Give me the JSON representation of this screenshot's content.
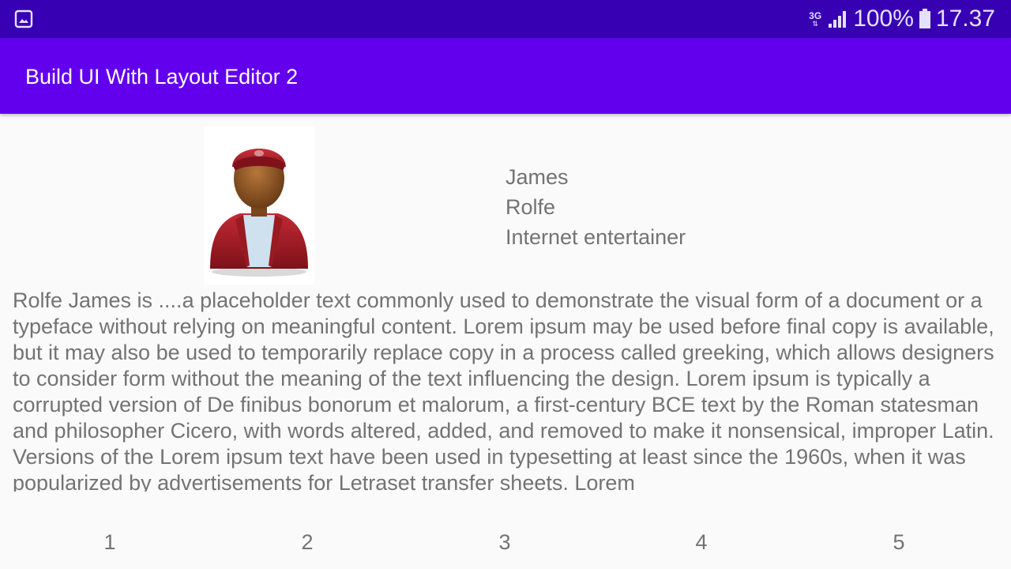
{
  "status_bar": {
    "network": "3G",
    "battery": "100%",
    "time": "17.37"
  },
  "app_bar": {
    "title": "Build UI With Layout Editor 2"
  },
  "profile": {
    "first_name": "James",
    "last_name": "Rolfe",
    "occupation": "Internet entertainer"
  },
  "description": "Rolfe James is ....a placeholder text commonly used to demonstrate the visual form of a document or a typeface without relying on meaningful content. Lorem ipsum may be used before final copy is available, but it may also be used to temporarily replace copy in a process called greeking, which allows designers to consider form without the meaning of the text influencing the design. Lorem ipsum is typically a corrupted version of De finibus bonorum et malorum, a first-century BCE text by the Roman statesman and philosopher Cicero, with words altered, added, and removed to make it nonsensical, improper Latin. Versions of the Lorem ipsum text have been used in typesetting at least since the 1960s, when it was popularized by advertisements for Letraset transfer sheets. Lorem",
  "numbers": [
    "1",
    "2",
    "3",
    "4",
    "5"
  ],
  "colors": {
    "status_bar": "#3700b3",
    "app_bar": "#6200ee",
    "text": "#737373"
  }
}
